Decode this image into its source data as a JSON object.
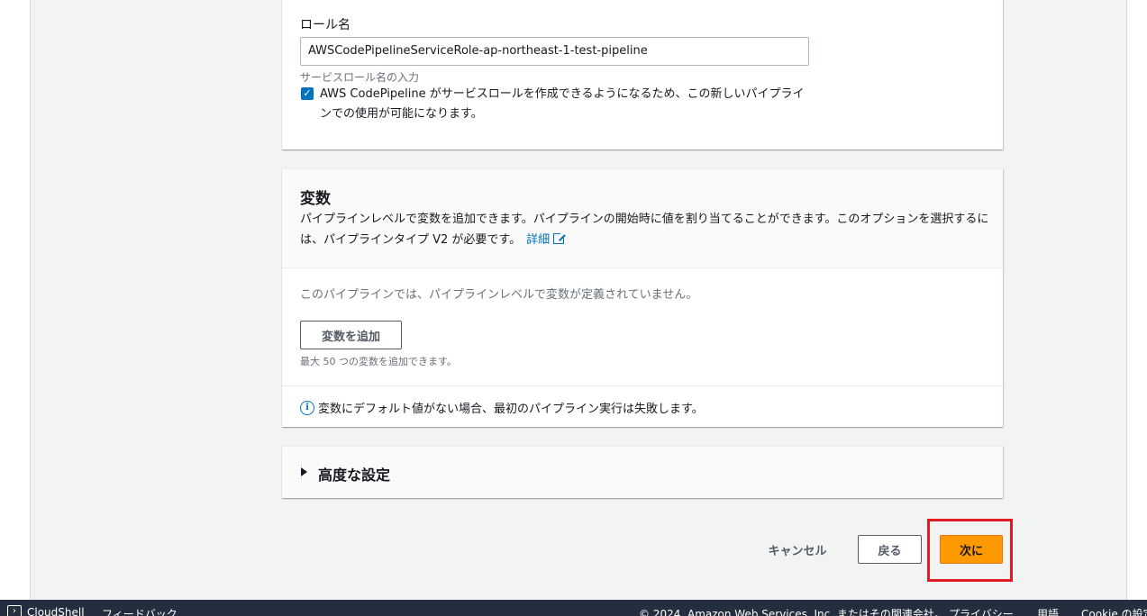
{
  "role": {
    "label": "ロール名",
    "input_value": "AWSCodePipelineServiceRole-ap-northeast-1-test-pipeline",
    "hint": "サービスロール名の入力",
    "checkbox_checked": true,
    "checkbox_label": "AWS CodePipeline がサービスロールを作成できるようになるため、この新しいパイプラインでの使用が可能になります。"
  },
  "variables": {
    "title": "変数",
    "description": "パイプラインレベルで変数を追加できます。パイプラインの開始時に値を割り当てることができます。このオプションを選択するには、パイプラインタイプ V2 が必要です。",
    "learn_more": "詳細",
    "empty_text": "このパイプラインでは、パイプラインレベルで変数が定義されていません。",
    "add_button": "変数を追加",
    "limit_text": "最大 50 つの変数を追加できます。",
    "info_text": "変数にデフォルト値がない場合、最初のパイプライン実行は失敗します。"
  },
  "advanced": {
    "title": "高度な設定"
  },
  "actions": {
    "cancel": "キャンセル",
    "back": "戻る",
    "next": "次に"
  },
  "footer": {
    "cloudshell": "CloudShell",
    "feedback": "フィードバック",
    "copyright": "© 2024, Amazon Web Services, Inc. またはその関連会社。",
    "privacy": "プライバシー",
    "terms": "用語",
    "cookie": "Cookie の設定"
  },
  "colors": {
    "primary": "#ff9900",
    "link": "#0073bb",
    "highlight": "#e01b24",
    "footer_bg": "#232f3e"
  }
}
